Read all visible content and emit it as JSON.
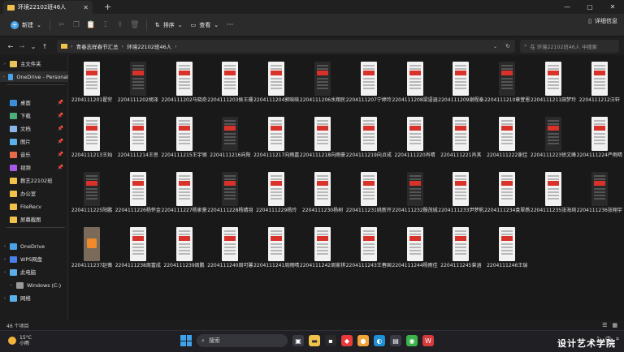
{
  "window": {
    "tab_title": "环境22102班46人",
    "new_tab": "+",
    "minimize": "—",
    "maximize": "▢",
    "close": "✕"
  },
  "toolbar": {
    "new_label": "新建",
    "sort_label": "排序",
    "view_label": "查看",
    "more": "···",
    "details": "详细信息"
  },
  "address": {
    "crumbs": [
      "青春志样春节汇总",
      "环境22102班46人"
    ],
    "search_placeholder": "在 环境22102班46人 中搜索"
  },
  "sidebar": {
    "items": [
      {
        "label": "主文件夹",
        "icon": "home-icon",
        "color": "#e8c35a",
        "pinned": false
      },
      {
        "label": "OneDrive - Personal",
        "icon": "cloud-icon",
        "color": "#4aa3e8",
        "pinned": false
      },
      {
        "label": "桌面",
        "icon": "desktop-icon",
        "color": "#3a8fd6",
        "pinned": true
      },
      {
        "label": "下载",
        "icon": "download-icon",
        "color": "#4caf7a",
        "pinned": true
      },
      {
        "label": "文档",
        "icon": "document-icon",
        "color": "#8ab4e8",
        "pinned": true
      },
      {
        "label": "图片",
        "icon": "pictures-icon",
        "color": "#5ab0e8",
        "pinned": true
      },
      {
        "label": "音乐",
        "icon": "music-icon",
        "color": "#e86a4a",
        "pinned": true
      },
      {
        "label": "视频",
        "icon": "video-icon",
        "color": "#a45ae8",
        "pinned": true
      },
      {
        "label": "教艺22102班",
        "icon": "folder-icon",
        "color": "#f0c24b",
        "pinned": false
      },
      {
        "label": "办公室",
        "icon": "folder-icon",
        "color": "#f0c24b",
        "pinned": false
      },
      {
        "label": "FileRecv",
        "icon": "folder-icon",
        "color": "#f0c24b",
        "pinned": false
      },
      {
        "label": "屏幕截图",
        "icon": "folder-icon",
        "color": "#f0c24b",
        "pinned": false
      },
      {
        "label": "OneDrive",
        "icon": "cloud-icon",
        "color": "#4aa3e8",
        "pinned": false
      },
      {
        "label": "WPS网盘",
        "icon": "wps-cloud-icon",
        "color": "#4a7ee8",
        "pinned": false
      },
      {
        "label": "此电脑",
        "icon": "computer-icon",
        "color": "#5ab0e8",
        "pinned": false
      },
      {
        "label": "Windows (C:)",
        "icon": "drive-icon",
        "color": "#9a9a9a",
        "pinned": false
      },
      {
        "label": "网络",
        "icon": "network-icon",
        "color": "#5ab0e8",
        "pinned": false
      }
    ]
  },
  "files": [
    {
      "name": "2204111201翟穷",
      "style": "light"
    },
    {
      "name": "2204111202胡泽",
      "style": "dark"
    },
    {
      "name": "2204111202马晓奇",
      "style": "light"
    },
    {
      "name": "2204111203侯王珊",
      "style": "light"
    },
    {
      "name": "2204111204郭晗晗",
      "style": "light"
    },
    {
      "name": "2204111206水翔民",
      "style": "dark"
    },
    {
      "name": "2204111207宁婷玲",
      "style": "light"
    },
    {
      "name": "2204111208梁语涵",
      "style": "light"
    },
    {
      "name": "2204111209谢程泰",
      "style": "light"
    },
    {
      "name": "2204111210章萱恩",
      "style": "dark"
    },
    {
      "name": "2204111211田梦玲",
      "style": "light"
    },
    {
      "name": "2204111212汪轩",
      "style": "light"
    },
    {
      "name": "2204111213王灿",
      "style": "light"
    },
    {
      "name": "2204111214王思",
      "style": "light"
    },
    {
      "name": "2204111215王宇钢",
      "style": "light"
    },
    {
      "name": "2204111216向阳",
      "style": "dark"
    },
    {
      "name": "2204111217向雨嘉",
      "style": "light"
    },
    {
      "name": "2204111218向雨豪",
      "style": "light"
    },
    {
      "name": "2204111219向贞成",
      "style": "light"
    },
    {
      "name": "2204111220肖晴",
      "style": "light"
    },
    {
      "name": "2204111221肖其",
      "style": "light"
    },
    {
      "name": "2204111222谢佳",
      "style": "light"
    },
    {
      "name": "2204111223徐文峰",
      "style": "dark"
    },
    {
      "name": "2204111224严雨晴",
      "style": "light"
    },
    {
      "name": "2204111225阳鹏",
      "style": "dark"
    },
    {
      "name": "2204111226杨怀金",
      "style": "light"
    },
    {
      "name": "2204111227杨家豪",
      "style": "light"
    },
    {
      "name": "2204111228杨婧羽",
      "style": "dark"
    },
    {
      "name": "2204111229杨玲",
      "style": "light"
    },
    {
      "name": "2204111230杨树",
      "style": "light"
    },
    {
      "name": "2204111231姚新开",
      "style": "light"
    },
    {
      "name": "2204111232殷茂城",
      "style": "dark"
    },
    {
      "name": "2204111233尹梦帆",
      "style": "light"
    },
    {
      "name": "2204111234袁翠燕",
      "style": "light"
    },
    {
      "name": "2204111235张海琦",
      "style": "light"
    },
    {
      "name": "2204111236张翔宇",
      "style": "dark"
    },
    {
      "name": "2204111237赵薇",
      "style": "photo"
    },
    {
      "name": "2204111238周富成",
      "style": "light"
    },
    {
      "name": "2204111239周鹏",
      "style": "light"
    },
    {
      "name": "2204111240周可馨",
      "style": "light"
    },
    {
      "name": "2204111241周雨晴",
      "style": "light"
    },
    {
      "name": "2204111242周家祺",
      "style": "light"
    },
    {
      "name": "2204111243王春国",
      "style": "light"
    },
    {
      "name": "2204111244杨雨佳",
      "style": "light"
    },
    {
      "name": "2204111245曾涵",
      "style": "light"
    },
    {
      "name": "2204111246王瑞",
      "style": "light"
    }
  ],
  "status": {
    "count": "46 个项目",
    "list_view": "☰",
    "grid_view": "▦"
  },
  "taskbar": {
    "temp": "15°C",
    "weather": "小雨",
    "search": "搜索",
    "ime": "中",
    "watermark": "设计艺术学院"
  }
}
